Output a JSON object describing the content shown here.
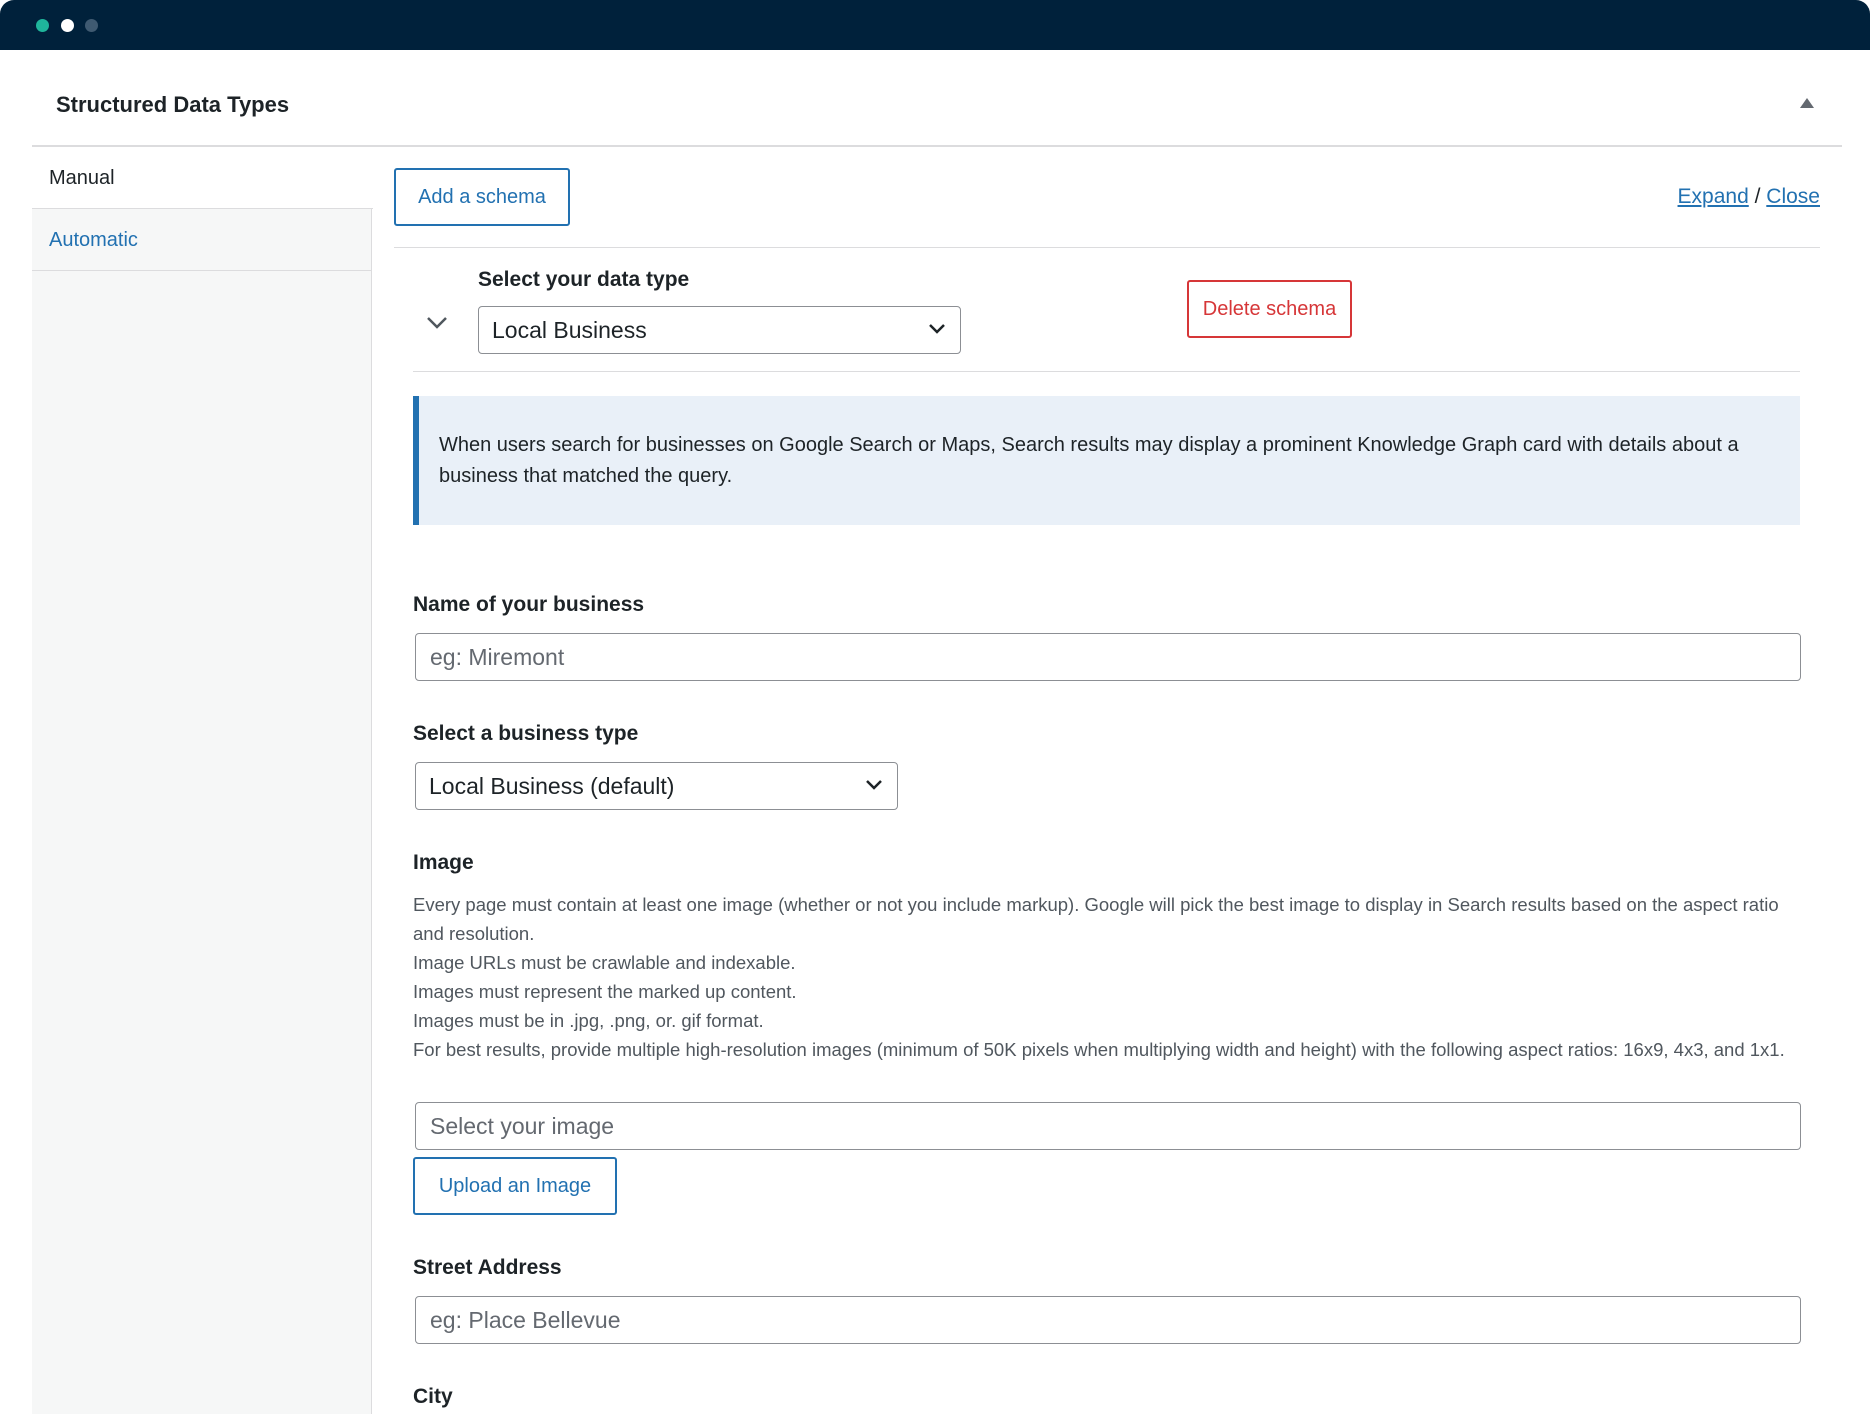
{
  "window": {
    "controls": [
      "close",
      "minimize",
      "maximize"
    ]
  },
  "panel": {
    "title": "Structured Data Types",
    "collapse_icon": "caret-up-icon"
  },
  "sidebar": {
    "tabs": [
      {
        "label": "Manual"
      },
      {
        "label": "Automatic"
      }
    ]
  },
  "toolbar": {
    "add_label": "Add a schema",
    "expand_label": "Expand",
    "separator": "/",
    "close_label": "Close"
  },
  "schema": {
    "toggle_icon": "chevron-down-icon",
    "type_label": "Select your data type",
    "type_value": "Local Business",
    "delete_label": "Delete schema",
    "notice": "When users search for businesses on Google Search or Maps, Search results may display a prominent Knowledge Graph card with details about a business that matched the query."
  },
  "fields": {
    "name": {
      "label": "Name of your business",
      "placeholder": "eg: Miremont"
    },
    "business_type": {
      "label": "Select a business type",
      "value": "Local Business (default)"
    },
    "image": {
      "label": "Image",
      "description": [
        "Every page must contain at least one image (whether or not you include markup). Google will pick the best image to display in Search results based on the aspect ratio and resolution.",
        "Image URLs must be crawlable and indexable.",
        "Images must represent the marked up content.",
        "Images must be in .jpg, .png, or. gif format.",
        "For best results, provide multiple high-resolution images (minimum of 50K pixels when multiplying width and height) with the following aspect ratios: 16x9, 4x3, and 1x1."
      ],
      "placeholder": "Select your image",
      "upload_label": "Upload an Image"
    },
    "street": {
      "label": "Street Address",
      "placeholder": "eg: Place Bellevue"
    },
    "city": {
      "label": "City"
    }
  },
  "colors": {
    "accent": "#2271b1",
    "danger": "#d63638",
    "titlebar": "#00213b",
    "notice_bg": "#e9f0f8"
  }
}
